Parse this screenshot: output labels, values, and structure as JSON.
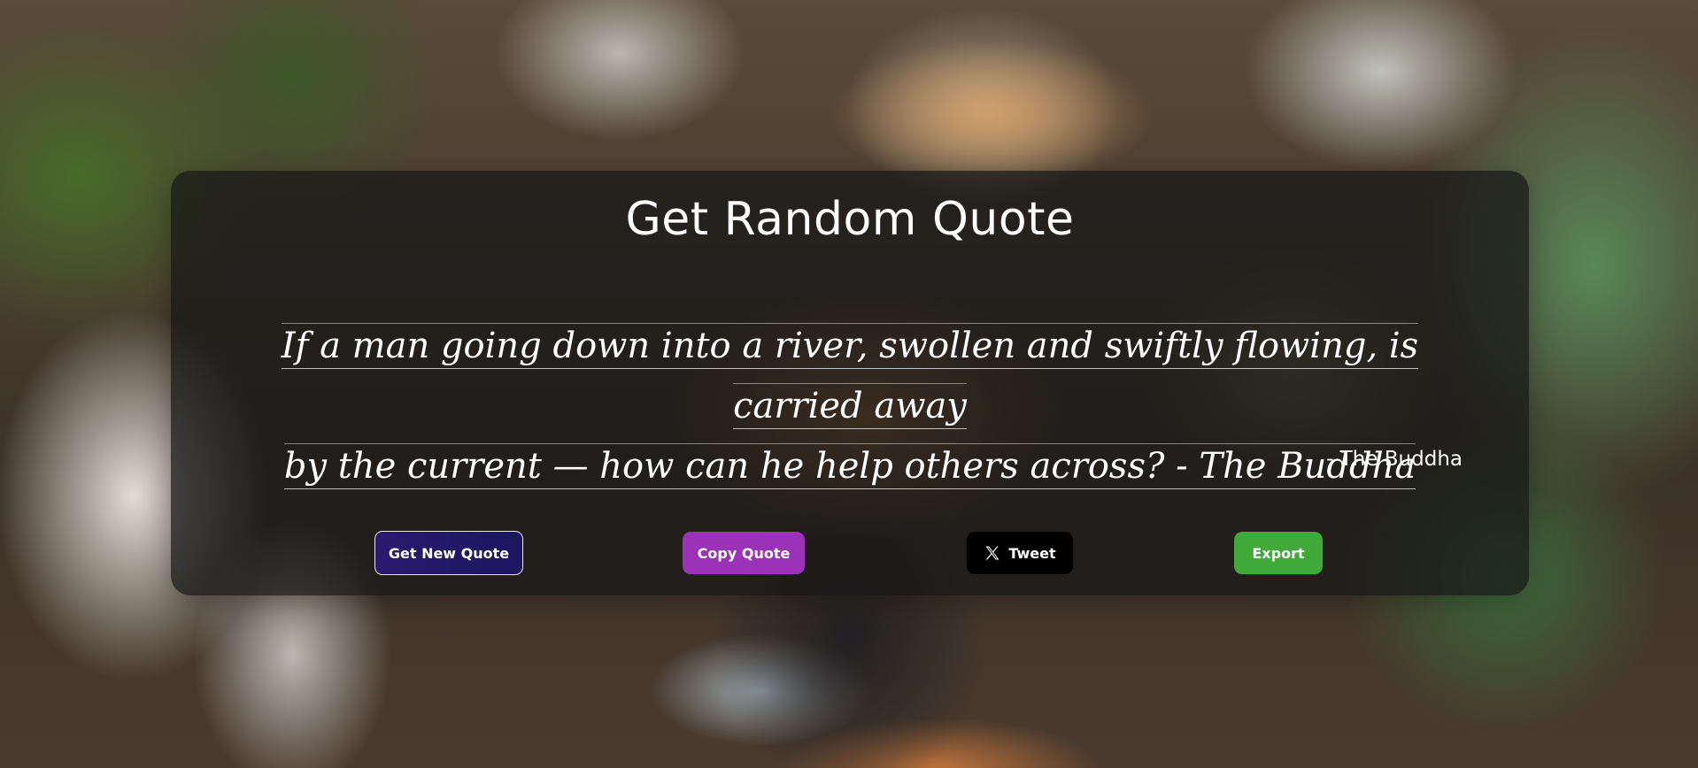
{
  "page": {
    "title": "Get Random Quote"
  },
  "quote": {
    "text_line1": "If a man going down into a river, swollen and swiftly flowing, is carried away",
    "text_line2": "by the current — how can he help others across? - The Buddha",
    "author": "- The Buddha"
  },
  "actions": {
    "new_quote_label": "Get New Quote",
    "copy_label": "Copy Quote",
    "tweet_label": "Tweet",
    "tweet_icon": "x-logo-icon",
    "export_label": "Export"
  },
  "colors": {
    "card_bg": "rgba(22,22,22,0.72)",
    "new_quote_bg": "#2a1a6e",
    "copy_bg": "#9b32b8",
    "tweet_bg": "#000000",
    "export_bg": "#3fa93a"
  }
}
